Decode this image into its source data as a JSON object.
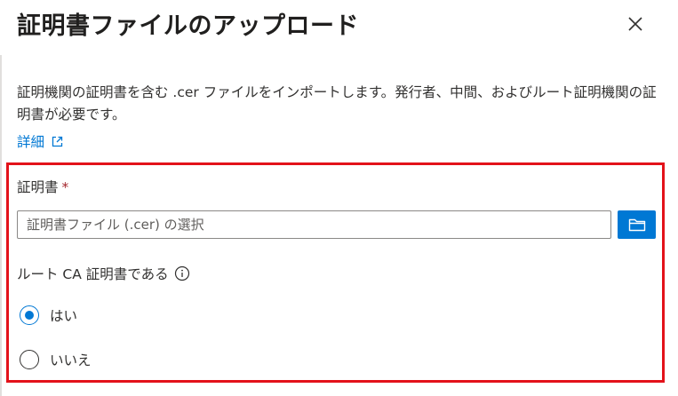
{
  "dialog": {
    "title": "証明書ファイルのアップロード",
    "close_icon": "close-icon",
    "description": "証明機関の証明書を含む .cer ファイルをインポートします。発行者、中間、およびルート証明機関の証明書が必要です。",
    "learn_more": "詳細",
    "learn_more_icon": "external-link-icon"
  },
  "form": {
    "certificate_label": "証明書",
    "required_marker": "*",
    "file_placeholder": "証明書ファイル (.cer) の選択",
    "browse_icon": "folder-icon",
    "root_ca_label": "ルート CA 証明書である",
    "info_icon": "info-icon",
    "root_ca_options": [
      {
        "label": "はい",
        "selected": true
      },
      {
        "label": "いいえ",
        "selected": false
      }
    ]
  },
  "colors": {
    "accent": "#0078d4",
    "highlight_border": "#e3121a",
    "required": "#a4262c"
  }
}
